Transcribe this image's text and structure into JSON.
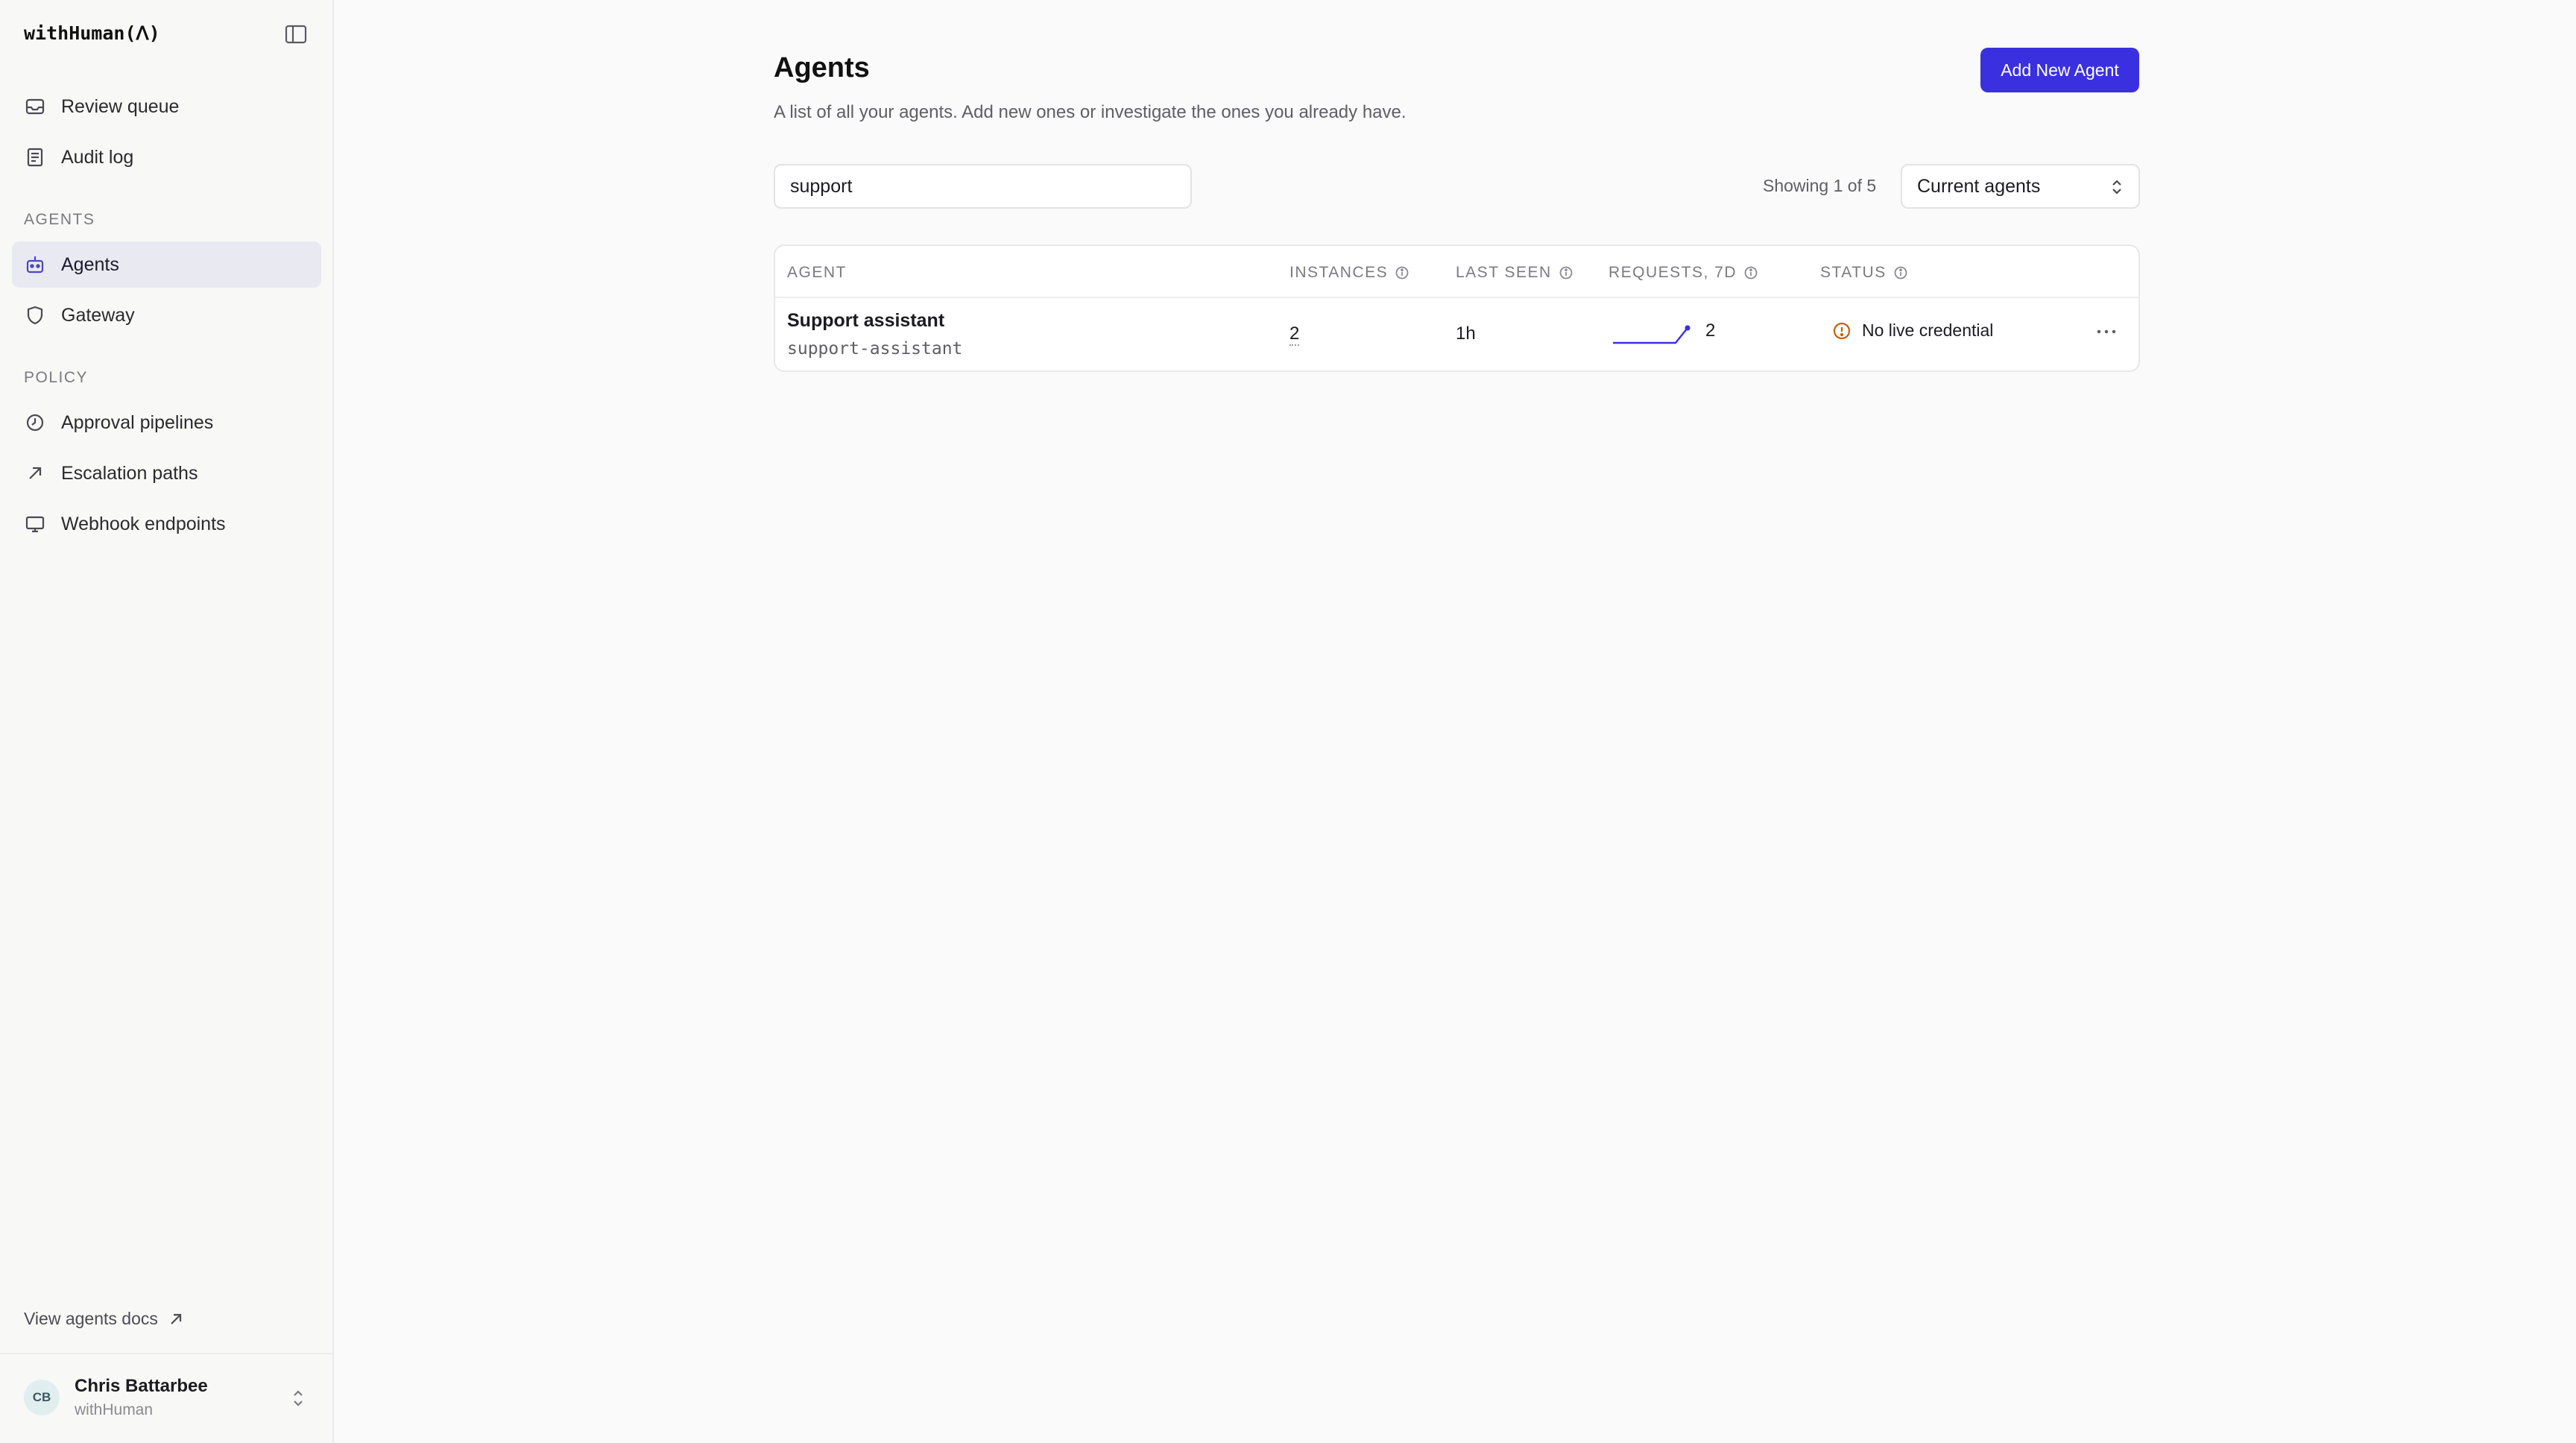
{
  "brand": {
    "name": "withHuman(ᐱ)"
  },
  "sidebar": {
    "items_top": [
      {
        "label": "Review queue",
        "icon": "inbox-icon"
      },
      {
        "label": "Audit log",
        "icon": "document-icon"
      }
    ],
    "agents_section": "AGENTS",
    "agents_items": [
      {
        "label": "Agents",
        "icon": "robot-icon",
        "active": true
      },
      {
        "label": "Gateway",
        "icon": "shield-icon"
      }
    ],
    "policy_section": "POLICY",
    "policy_items": [
      {
        "label": "Approval pipelines",
        "icon": "clock-icon"
      },
      {
        "label": "Escalation paths",
        "icon": "arrow-up-right-icon"
      },
      {
        "label": "Webhook endpoints",
        "icon": "monitor-icon"
      }
    ],
    "docs_link": "View agents docs"
  },
  "user": {
    "initials": "CB",
    "name": "Chris Battarbee",
    "org": "withHuman"
  },
  "page": {
    "title": "Agents",
    "subtitle": "A list of all your agents. Add new ones or investigate the ones you already have.",
    "add_button": "Add New Agent"
  },
  "search": {
    "value": "support"
  },
  "filter": {
    "showing": "Showing 1 of 5",
    "selected": "Current agents"
  },
  "table": {
    "headers": {
      "agent": "AGENT",
      "instances": "INSTANCES",
      "last_seen": "LAST SEEN",
      "requests": "REQUESTS, 7D",
      "status": "STATUS"
    },
    "rows": [
      {
        "name": "Support assistant",
        "slug": "support-assistant",
        "instances": "2",
        "last_seen": "1h",
        "requests": "2",
        "status": "No live credential"
      }
    ]
  },
  "colors": {
    "accent": "#3b30e0",
    "warning": "#c2610c",
    "sparkline": "#3b30e0"
  }
}
